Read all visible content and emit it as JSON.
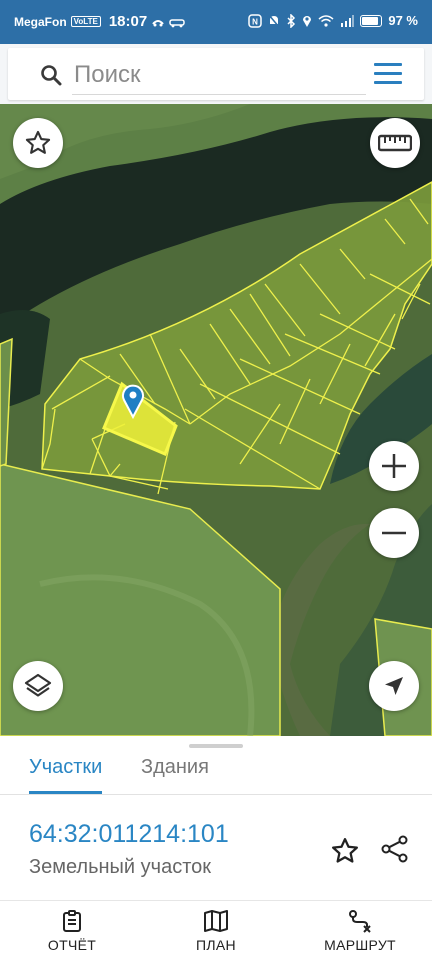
{
  "status_bar": {
    "carrier": "MegaFon",
    "volte": "VoLTE",
    "time": "18:07",
    "battery": "97 %",
    "battery_level": 0.97
  },
  "search": {
    "placeholder": "Поиск",
    "value": ""
  },
  "bottom_sheet": {
    "tabs": [
      {
        "label": "Участки",
        "active": true
      },
      {
        "label": "Здания",
        "active": false
      }
    ],
    "parcel": {
      "number": "64:32:011214:101",
      "type": "Земельный участок"
    }
  },
  "bottom_nav": [
    {
      "label": "ОТЧЁТ",
      "icon": "report-icon"
    },
    {
      "label": "ПЛАН",
      "icon": "map-plan-icon"
    },
    {
      "label": "МАРШРУТ",
      "icon": "route-icon"
    }
  ],
  "colors": {
    "status_bar": "#2d6fa7",
    "accent": "#2a86c4",
    "parcel_border": "#f1f14a",
    "selected_parcel": "#eef13a",
    "water": "#1b2a22"
  },
  "map_controls": [
    "favorites-icon",
    "ruler-icon",
    "zoom-in-icon",
    "zoom-out-icon",
    "layers-icon",
    "locate-icon"
  ]
}
